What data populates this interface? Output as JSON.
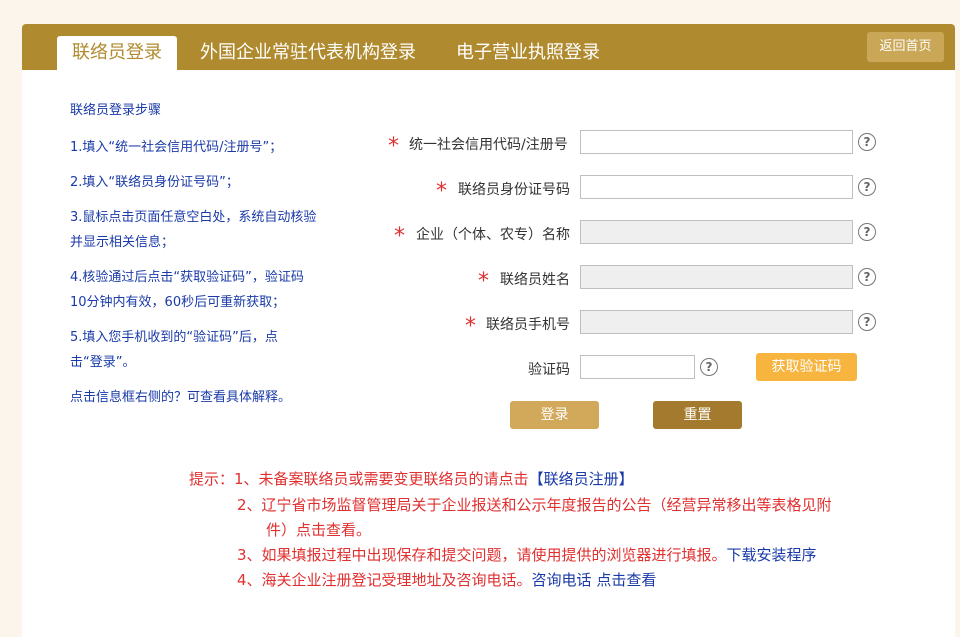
{
  "tabs": [
    {
      "label": "联络员登录"
    },
    {
      "label": "外国企业常驻代表机构登录"
    },
    {
      "label": "电子营业执照登录"
    }
  ],
  "home_button": "返回首页",
  "steps": {
    "title": "联络员登录步骤",
    "s1": "1.填入“统一社会信用代码/注册号”；",
    "s2": "2.填入“联络员身份证号码”；",
    "s3a": "3.鼠标点击页面任意空白处，系统自动核验",
    "s3b": "并显示相关信息；",
    "s4a": "4.核验通过后点击“获取验证码”，验证码",
    "s4b": "10分钟内有效，60秒后可重新获取；",
    "s5a": "5.填入您手机收到的“验证码”后，点",
    "s5b": "击“登录”。",
    "note": "点击信息框右侧的？可查看具体解释。"
  },
  "form": {
    "credit_code_label": "统一社会信用代码/注册号",
    "id_label": "联络员身份证号码",
    "company_label": "企业（个体、农专）名称",
    "name_label": "联络员姓名",
    "phone_label": "联络员手机号",
    "code_label": "验证码",
    "star": "*",
    "help": "?",
    "get_code": "获取验证码",
    "login": "登录",
    "reset": "重置"
  },
  "tips": {
    "prefix": "提示：",
    "t1": "1、未备案联络员或需要变更联络员的请点击",
    "t1_link": "【联络员注册】",
    "t2a": "2、辽宁省市场监督管理局关于企业报送和公示年度报告的公告（经营异常移出等表格见附",
    "t2b": "件）点击查看。",
    "t3": "3、如果填报过程中出现保存和提交问题，请使用提供的浏览器进行填报。",
    "t3_link": "下载安装程序",
    "t4": "4、海关企业注册登记受理地址及咨询电话。",
    "t4_link": "咨询电话 点击查看"
  }
}
